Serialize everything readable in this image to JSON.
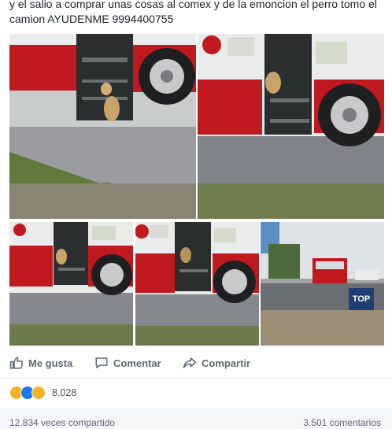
{
  "post": {
    "text": "y el salio a comprar unas cosas al comex y de la emoncion el perro tomo el camion AYUDENME 9994400755"
  },
  "photos": [
    {
      "label": "Perro bajando del camión"
    },
    {
      "label": "Camión con perro en la puerta"
    },
    {
      "label": "Perro subiendo al camión"
    },
    {
      "label": "Perro dentro del camión"
    },
    {
      "label": "Camión con logos"
    },
    {
      "label": "Calle con camión a lo lejos",
      "bin_text": "TOP"
    }
  ],
  "actions": {
    "like": "Me gusta",
    "comment": "Comentar",
    "share": "Compartir"
  },
  "reactions": {
    "count": "8.028",
    "icons": [
      "haha-icon",
      "like-icon",
      "sad-icon"
    ]
  },
  "stats": {
    "shares": "12.834 veces compartido",
    "comments": "3.501 comentarios"
  },
  "colors": {
    "bus_red": "#c0191f",
    "bus_white": "#eef0ee",
    "facebook_blue": "#1877f2",
    "text_gray": "#606770"
  }
}
